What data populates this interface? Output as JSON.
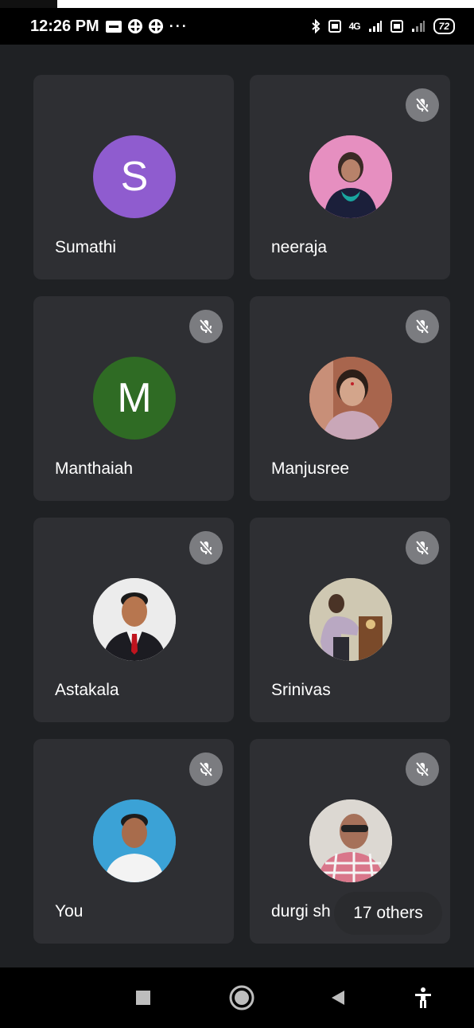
{
  "status_bar": {
    "time": "12:26 PM",
    "icons": [
      "message-icon",
      "vpn-icon",
      "vpn-icon",
      "more-dots-icon"
    ],
    "dots": "···",
    "right_icons": [
      "bluetooth-icon",
      "volte-icon",
      "signal-icon",
      "volte-icon",
      "signal-icon"
    ],
    "battery": "72",
    "sig1_label": "4G",
    "sig2_label": ".ıl"
  },
  "participants": [
    {
      "name": "Sumathi",
      "initial": "S",
      "avatar_color": "#8f5ccf",
      "muted": false,
      "photo": false
    },
    {
      "name": "neeraja",
      "initial": "",
      "avatar_color": "#d96aa8",
      "muted": true,
      "photo": true
    },
    {
      "name": "Manthaiah",
      "initial": "M",
      "avatar_color": "#2f6b24",
      "muted": true,
      "photo": false
    },
    {
      "name": "Manjusree",
      "initial": "",
      "avatar_color": "#b97a5f",
      "muted": true,
      "photo": true
    },
    {
      "name": "Astakala",
      "initial": "",
      "avatar_color": "#e9e9e9",
      "muted": true,
      "photo": true
    },
    {
      "name": "Srinivas",
      "initial": "",
      "avatar_color": "#c9c3ad",
      "muted": true,
      "photo": true
    },
    {
      "name": "You",
      "initial": "",
      "avatar_color": "#3a9fd2",
      "muted": true,
      "photo": true
    },
    {
      "name": "durgi sh",
      "initial": "",
      "avatar_color": "#d6d2cc",
      "muted": true,
      "photo": true
    }
  ],
  "others_label": "17 others",
  "colors": {
    "background": "#1f2124",
    "tile": "#2e2f33",
    "mute_badge": "#7b7c80"
  },
  "nav": [
    "recents-square-icon",
    "home-circle-icon",
    "back-triangle-icon",
    "accessibility-icon"
  ]
}
